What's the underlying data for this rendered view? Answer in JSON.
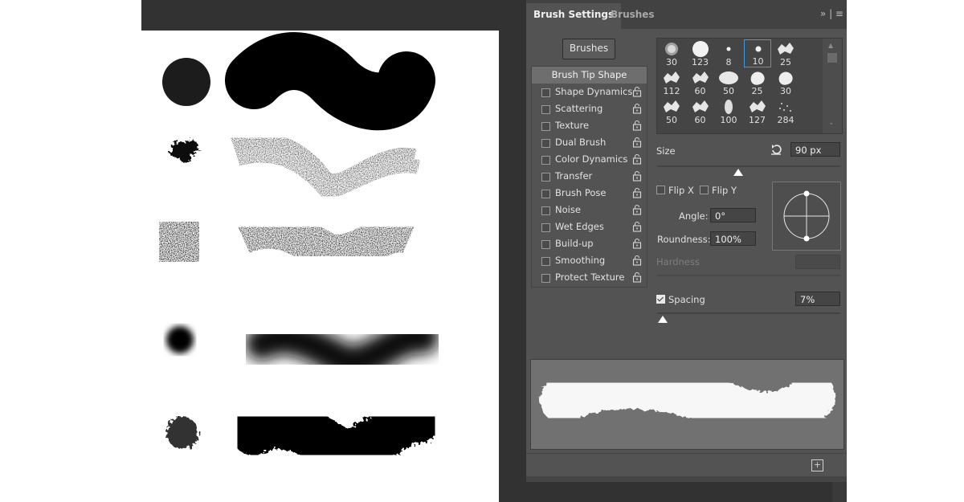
{
  "panel": {
    "tabs": [
      {
        "label": "Brush Settings"
      },
      {
        "label": "Brushes"
      }
    ],
    "menu_glyph": "»  |  ≡",
    "brushes_button": "Brushes",
    "options": [
      {
        "label": "Brush Tip Shape",
        "header": true
      },
      {
        "label": "Shape Dynamics"
      },
      {
        "label": "Scattering"
      },
      {
        "label": "Texture"
      },
      {
        "label": "Dual Brush"
      },
      {
        "label": "Color Dynamics"
      },
      {
        "label": "Transfer"
      },
      {
        "label": "Brush Pose"
      },
      {
        "label": "Noise"
      },
      {
        "label": "Wet Edges"
      },
      {
        "label": "Build-up"
      },
      {
        "label": "Smoothing"
      },
      {
        "label": "Protect Texture"
      }
    ],
    "presets": [
      "30",
      "123",
      "8",
      "10",
      "25",
      "112",
      "60",
      "50",
      "25",
      "30",
      "50",
      "60",
      "100",
      "127",
      "284"
    ],
    "size": {
      "label": "Size",
      "value": "90 px",
      "slider": 0.5
    },
    "flip_x": "Flip X",
    "flip_y": "Flip Y",
    "angle": {
      "label": "Angle:",
      "value": "0°"
    },
    "roundness": {
      "label": "Roundness:",
      "value": "100%"
    },
    "hardness": {
      "label": "Hardness"
    },
    "spacing": {
      "label": "Spacing",
      "value": "7%",
      "checked": true,
      "slider": 0.03
    },
    "new_preset_icon": "new-brush-icon",
    "accent_color": "#3a9be8"
  }
}
